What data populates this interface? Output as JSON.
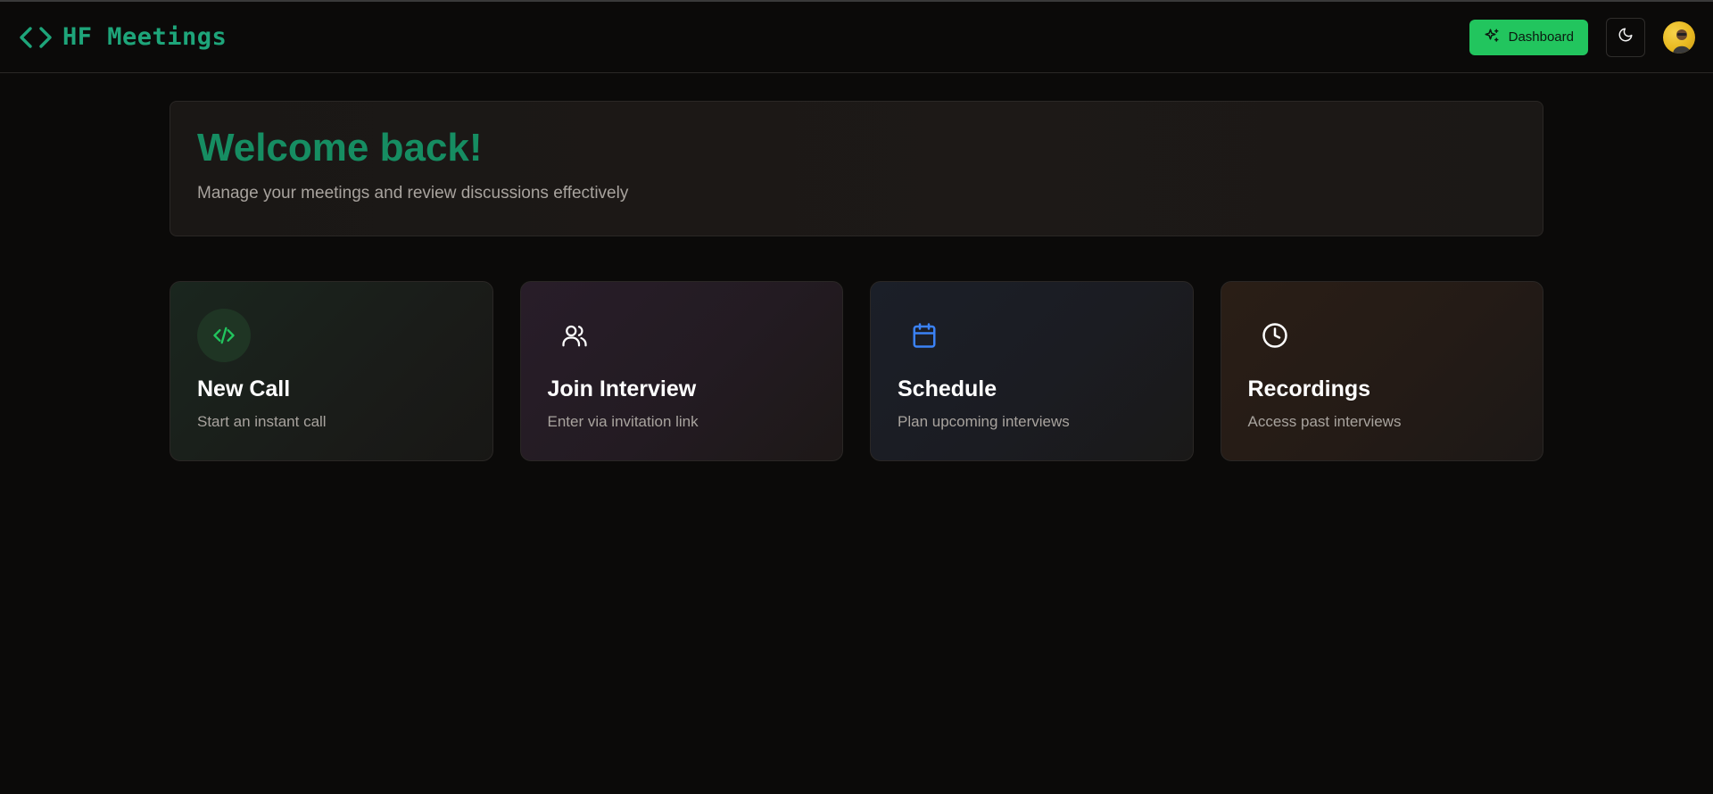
{
  "header": {
    "brand": "HF Meetings",
    "dashboard_label": "Dashboard"
  },
  "welcome": {
    "title": "Welcome back!",
    "subtitle": "Manage your meetings and review discussions effectively"
  },
  "cards": [
    {
      "title": "New Call",
      "description": "Start an instant call",
      "icon": "code-icon"
    },
    {
      "title": "Join Interview",
      "description": "Enter via invitation link",
      "icon": "users-icon"
    },
    {
      "title": "Schedule",
      "description": "Plan upcoming interviews",
      "icon": "calendar-icon"
    },
    {
      "title": "Recordings",
      "description": "Access past interviews",
      "icon": "clock-icon"
    }
  ],
  "colors": {
    "accent": "#1ea57a",
    "button": "#22c55e",
    "background": "#0b0a09"
  }
}
